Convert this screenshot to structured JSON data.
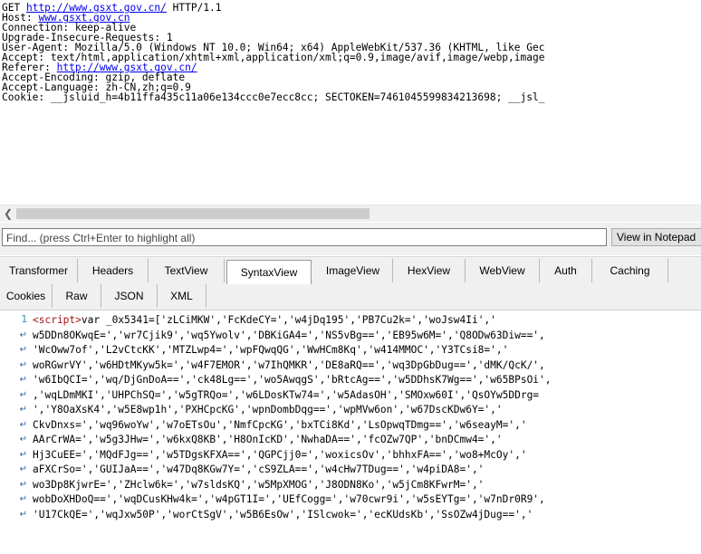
{
  "request": {
    "method": "GET",
    "url": "http://www.gsxt.gov.cn/",
    "protocol": "HTTP/1.1",
    "host_key": "Host:",
    "host_value": "www.gsxt.gov.cn",
    "connection": "Connection: keep-alive",
    "upgrade": "Upgrade-Insecure-Requests: 1",
    "user_agent": "User-Agent: Mozilla/5.0 (Windows NT 10.0; Win64; x64) AppleWebKit/537.36 (KHTML, like Gec",
    "accept": "Accept: text/html,application/xhtml+xml,application/xml;q=0.9,image/avif,image/webp,image",
    "referer_key": "Referer:",
    "referer_value": "http://www.gsxt.gov.cn/",
    "accept_encoding": "Accept-Encoding: gzip, deflate",
    "accept_language": "Accept-Language: zh-CN,zh;q=0.9",
    "cookie": "Cookie: __jsluid_h=4b11ffa435c11a06e134ccc0e7ecc8cc; SECTOKEN=7461045599834213698; __jsl_"
  },
  "find": {
    "placeholder": "Find... (press Ctrl+Enter to highlight all)",
    "view_button": "View in Notepad"
  },
  "tabs_row1": [
    "Transformer",
    "Headers",
    "TextView",
    "SyntaxView",
    "ImageView",
    "HexView",
    "WebView",
    "Auth",
    "Caching"
  ],
  "tabs_row2": [
    "Cookies",
    "Raw",
    "JSON",
    "XML"
  ],
  "active_tab": "SyntaxView",
  "code": {
    "line_number": "1",
    "open_tag": "<script>",
    "line1_rest": "var _0x5341=['zLCiMKW','FcKdeCY=','w4jDq195','PB7Cu2k=','woJsw4Ii','",
    "wrapped_lines": [
      "w5DDn8OKwqE=','wr7Cjik9','wq5Ywolv','DBKiGA4=','NS5vBg==','EB95w6M=','Q8ODw63Diw==',",
      "'WcOww7of','L2vCtcKK','MTZLwp4=','wpFQwqQG','WwHCm8Kq','w414MMOC','Y3TCsi8=','",
      "woRGwrVY','w6HDtMKyw5k=','w4F7EMOR','w7IhQMKR','DE8aRQ==','wq3DpGbDug==','dMK/QcK/',",
      "'w6IbQCI=','wq/DjGnDoA==','ck48Lg==','wo5AwqgS','bRtcAg==','w5DDhsK7Wg==','w65BPsOi',",
      ",'wqLDmMKI','UHPChSQ=','w5gTRQo=','w6LDosKTw74=','w5AdasOH','SMOxw60I','QsOYw5DDrg=",
      "','Y8OaXsK4','w5E8wp1h','PXHCpcKG','wpnDombDqg==','wpMVw6on','w67DscKDw6Y=','",
      "CkvDnxs=','wq96woYw','w7oETsOu','NmfCpcKG','bxTCi8Kd','LsOpwqTDmg==','w6seayM=','",
      "AArCrWA=','w5g3JHw=','w6kxQ8KB','H8OnIcKD','NwhaDA==','fcOZw7QP','bnDCmw4=','",
      "Hj3CuEE=','MQdFJg==','w5TDgsKFXA==','QGPCjj0=','woxicsOv','bhhxFA==','wo8+McOy','",
      "aFXCrSo=','GUIJaA==','w47Dq8KGw7Y=','cS9ZLA==','w4cHw7TDug==','w4piDA8=','",
      "wo3Dp8KjwrE=','ZHclw6k=','w7sldsKQ','w5MpXMOG','J8ODN8Ko','w5jCm8KFwrM=','",
      "wobDoXHDoQ==','wqDCusKHw4k=','w4pGT1I=','UEfCogg=','w70cwr9i','w5sEYTg=','w7nDr0R9',",
      "'U17CkQE=','wqJxw50P','worCtSgV','w5B6EsOw','ISlcwok=','ecKUdsKb','SsOZw4jDug==','"
    ]
  }
}
